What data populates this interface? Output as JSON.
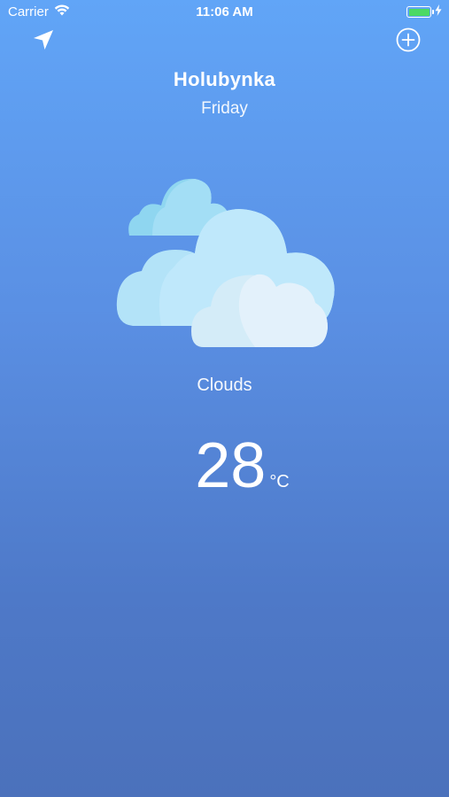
{
  "status_bar": {
    "carrier": "Carrier",
    "time": "11:06 AM",
    "battery_level": 1.0,
    "battery_color": "#4cd964"
  },
  "toolbar": {
    "location_icon": "location-arrow-icon",
    "add_icon": "plus-circle-icon"
  },
  "location": {
    "city": "Holubynka",
    "day": "Friday"
  },
  "weather": {
    "icon": "clouds-icon",
    "condition": "Clouds",
    "temperature": "28",
    "unit": "°C"
  },
  "colors": {
    "background_top": "#61a5f7",
    "background_bottom": "#4b71bb",
    "text": "#ffffff"
  }
}
